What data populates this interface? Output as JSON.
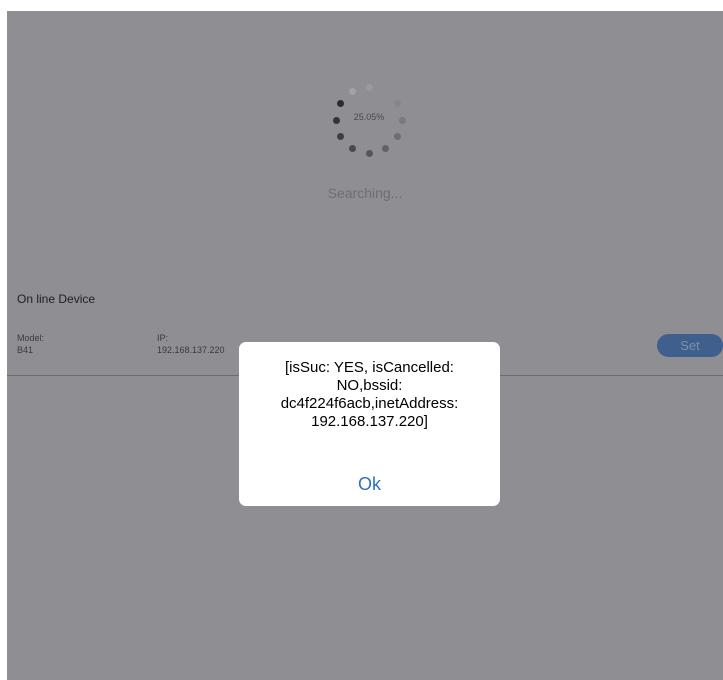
{
  "progress": {
    "percent_text": "25.05%",
    "value_percent": 25.05,
    "status_text": "Searching..."
  },
  "section": {
    "title": "On line Device"
  },
  "device": {
    "model_label": "Model:",
    "model_value": "B41",
    "ip_label": "IP:",
    "ip_value": "192.168.137.220",
    "set_label": "Set"
  },
  "dialog": {
    "message": "[isSuc: YES, isCancelled: NO,bssid: dc4f224f6acb,inetAddress: 192.168.137.220]",
    "ok_label": "Ok"
  },
  "colors": {
    "overlay_background": "#8e8e93",
    "accent": "#2f6fc0",
    "set_button": "#3f5f8c"
  },
  "icons": {
    "spinner": "loading-spinner-icon"
  }
}
